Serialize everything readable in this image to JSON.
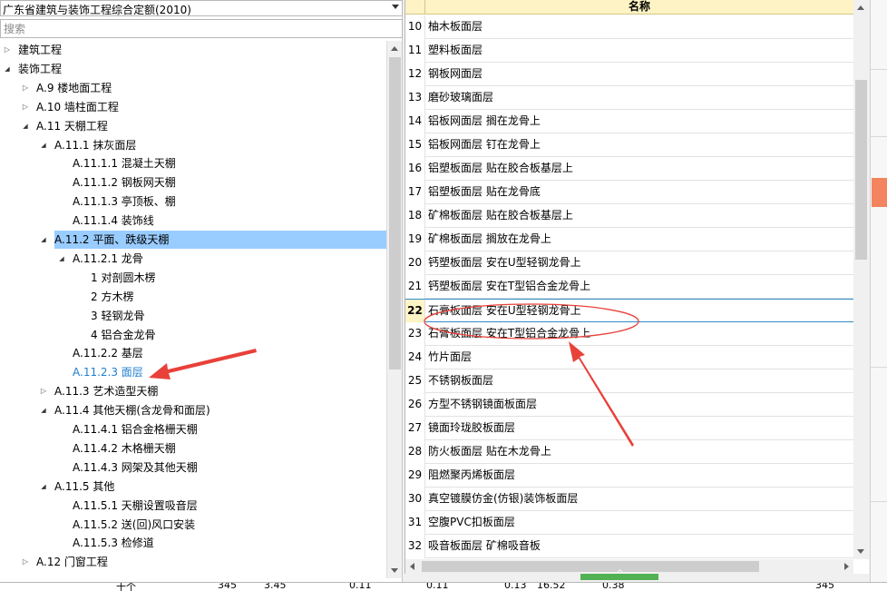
{
  "quota_dropdown": {
    "value": "广东省建筑与装饰工程综合定额(2010)"
  },
  "search": {
    "placeholder": "搜索"
  },
  "tree": [
    {
      "label": "建筑工程",
      "state": "collapsed"
    },
    {
      "label": "装饰工程",
      "state": "expanded"
    },
    {
      "label": "A.9 楼地面工程",
      "state": "collapsed"
    },
    {
      "label": "A.10 墙柱面工程",
      "state": "collapsed"
    },
    {
      "label": "A.11 天棚工程",
      "state": "expanded"
    },
    {
      "label": "A.11.1 抹灰面层",
      "state": "expanded"
    },
    {
      "label": "A.11.1.1 混凝土天棚",
      "state": "leaf"
    },
    {
      "label": "A.11.1.2 钢板网天棚",
      "state": "leaf"
    },
    {
      "label": "A.11.1.3 亭顶板、棚",
      "state": "leaf"
    },
    {
      "label": "A.11.1.4 装饰线",
      "state": "leaf"
    },
    {
      "label": "A.11.2 平面、跌级天棚",
      "state": "expanded",
      "selected": true
    },
    {
      "label": "A.11.2.1 龙骨",
      "state": "expanded"
    },
    {
      "label": "1 对剖圆木楞",
      "state": "leaf"
    },
    {
      "label": "2 方木楞",
      "state": "leaf"
    },
    {
      "label": "3 轻钢龙骨",
      "state": "leaf"
    },
    {
      "label": "4 铝合金龙骨",
      "state": "leaf"
    },
    {
      "label": "A.11.2.2 基层",
      "state": "leaf"
    },
    {
      "label": "A.11.2.3 面层",
      "state": "leaf",
      "current": true
    },
    {
      "label": "A.11.3 艺术造型天棚",
      "state": "collapsed"
    },
    {
      "label": "A.11.4 其他天棚(含龙骨和面层)",
      "state": "expanded"
    },
    {
      "label": "A.11.4.1 铝合金格栅天棚",
      "state": "leaf"
    },
    {
      "label": "A.11.4.2 木格栅天棚",
      "state": "leaf"
    },
    {
      "label": "A.11.4.3 网架及其他天棚",
      "state": "leaf"
    },
    {
      "label": "A.11.5 其他",
      "state": "expanded"
    },
    {
      "label": "A.11.5.1 天棚设置吸音层",
      "state": "leaf"
    },
    {
      "label": "A.11.5.2 送(回)风口安装",
      "state": "leaf"
    },
    {
      "label": "A.11.5.3 检修道",
      "state": "leaf"
    },
    {
      "label": "A.12 门窗工程",
      "state": "collapsed"
    }
  ],
  "table": {
    "header": "名称",
    "active_row": 22,
    "rows": [
      {
        "no": "10",
        "name": "柚木板面层"
      },
      {
        "no": "11",
        "name": "塑料板面层"
      },
      {
        "no": "12",
        "name": "钢板网面层"
      },
      {
        "no": "13",
        "name": "磨砂玻璃面层"
      },
      {
        "no": "14",
        "name": "铝板网面层 搁在龙骨上"
      },
      {
        "no": "15",
        "name": "铝板网面层 钉在龙骨上"
      },
      {
        "no": "16",
        "name": "铝塑板面层 贴在胶合板基层上"
      },
      {
        "no": "17",
        "name": "铝塑板面层 贴在龙骨底"
      },
      {
        "no": "18",
        "name": "矿棉板面层 贴在胶合板基层上"
      },
      {
        "no": "19",
        "name": "矿棉板面层 搁放在龙骨上"
      },
      {
        "no": "20",
        "name": "钙塑板面层 安在U型轻钢龙骨上"
      },
      {
        "no": "21",
        "name": "钙塑板面层 安在T型铝合金龙骨上"
      },
      {
        "no": "22",
        "name": "石膏板面层 安在U型轻钢龙骨上"
      },
      {
        "no": "23",
        "name": "石膏板面层 安在T型铝合金龙骨上"
      },
      {
        "no": "24",
        "name": "竹片面层"
      },
      {
        "no": "25",
        "name": "不锈钢板面层"
      },
      {
        "no": "26",
        "name": "方型不锈钢镜面板面层"
      },
      {
        "no": "27",
        "name": "镜面玲珑胶板面层"
      },
      {
        "no": "28",
        "name": "防火板面层 贴在木龙骨上"
      },
      {
        "no": "29",
        "name": "阻燃聚丙烯板面层"
      },
      {
        "no": "30",
        "name": "真空镀膜仿金(仿银)装饰板面层"
      },
      {
        "no": "31",
        "name": "空腹PVC扣板面层"
      },
      {
        "no": "32",
        "name": "吸音板面层 矿棉吸音板"
      }
    ]
  },
  "bottom_row": [
    "十个",
    "345",
    "3.45",
    "0.11",
    "0.11",
    "0.13",
    "16.52",
    "0.38",
    "345"
  ],
  "colors": {
    "selection": "#99ccff",
    "current_link": "#1f7fd0",
    "header_bg": "#fdf3c4",
    "annotation_red": "#e8413a",
    "side_accent": "#f4845f"
  },
  "annotations": [
    "red-arrow-to-tree-item",
    "red-ellipse-around-row-22",
    "red-arrow-to-ellipse"
  ]
}
